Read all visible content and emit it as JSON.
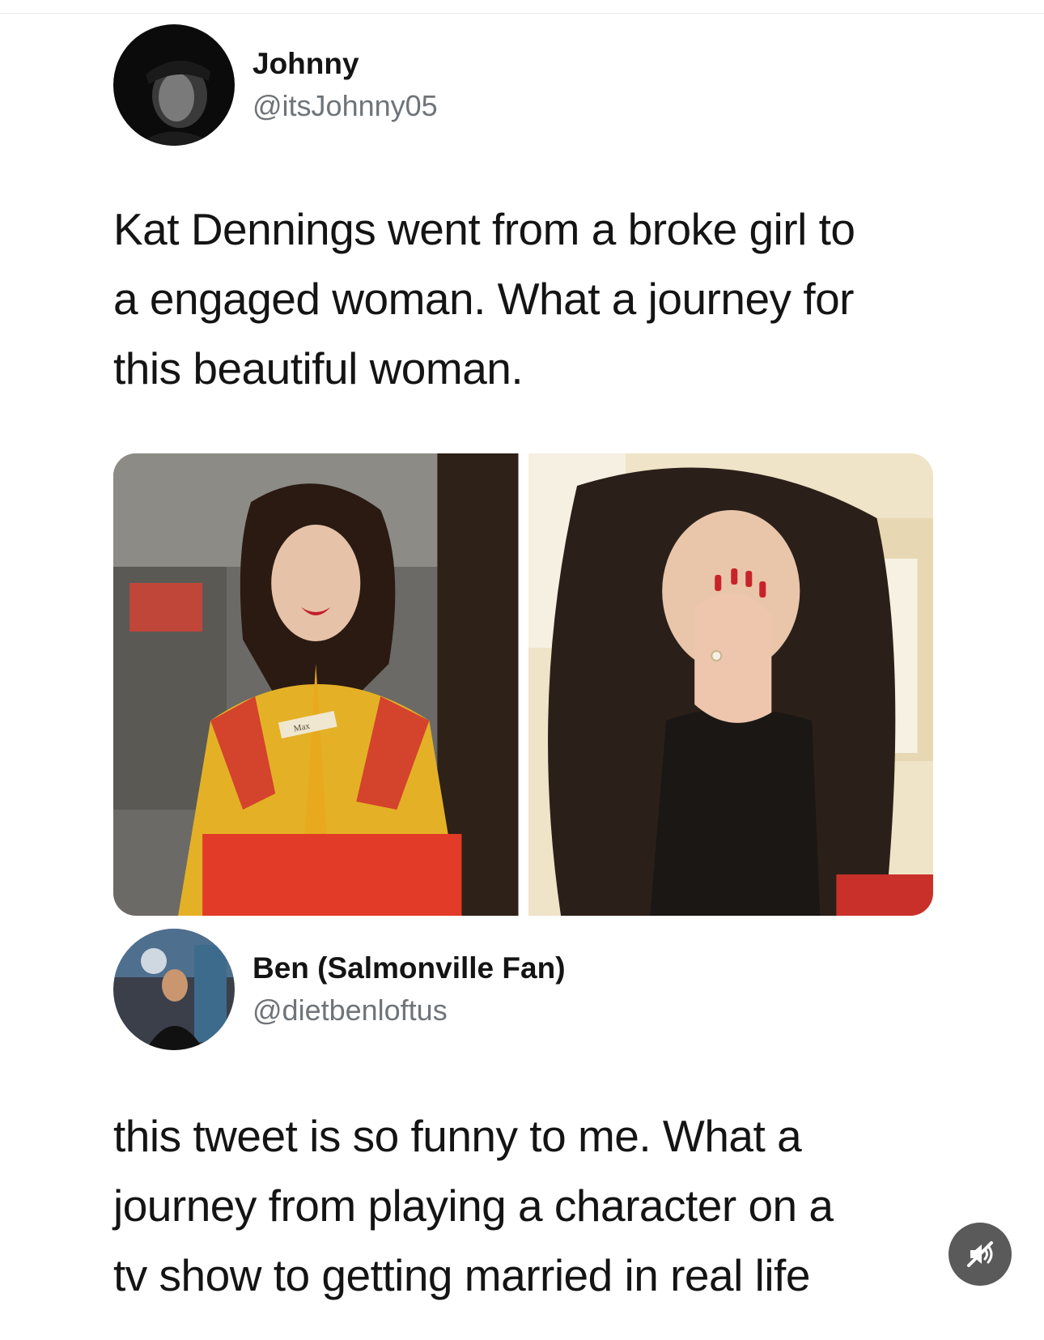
{
  "tweet": {
    "author": {
      "display_name": "Johnny",
      "handle": "@itsJohnny05"
    },
    "text": "Kat Dennings went from a broke girl to\na engaged woman. What a journey for\nthis beautiful woman.",
    "media": [
      {
        "name": "photo-left",
        "badge_text": "Max"
      },
      {
        "name": "photo-right"
      }
    ]
  },
  "reply": {
    "author": {
      "display_name": "Ben (Salmonville Fan)",
      "handle": "@dietbenloftus"
    },
    "text": "this tweet is so funny to me. What a\njourney from playing a character on a\ntv show to getting married in real life"
  },
  "controls": {
    "mute_icon": "speaker-muted-icon"
  },
  "colors": {
    "text": "#141414",
    "handle": "#6f7479",
    "mute_button_bg": "#5a5a5a"
  }
}
